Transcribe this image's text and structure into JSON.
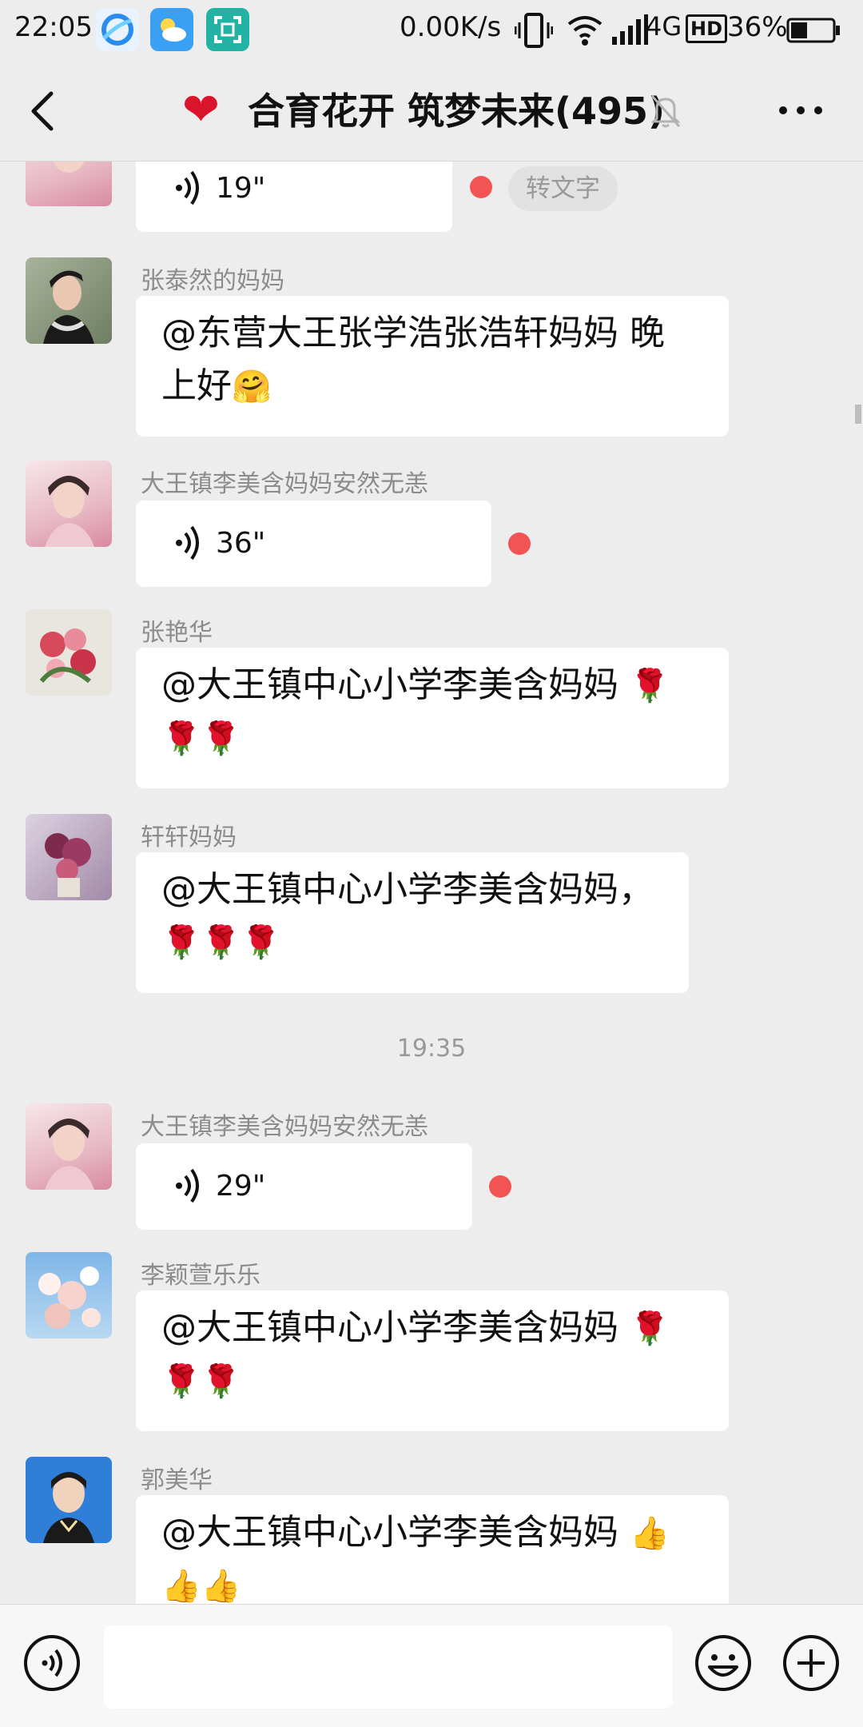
{
  "status_bar": {
    "time": "22:05",
    "network_speed": "0.00K/s",
    "network_type": "4G",
    "hd": "HD",
    "battery": "36%"
  },
  "header": {
    "back_icon": "chevron-left-icon",
    "title": "合育花开 筑梦未来(495)",
    "mute_icon": "bell-muted-icon",
    "more_icon": "more-icon"
  },
  "messages": [
    {
      "type": "voice",
      "duration": "19\"",
      "unread": true,
      "transcribe_label": "转文字"
    },
    {
      "type": "text",
      "sender": "张泰然的妈妈",
      "text_line1": "@东营大王张学浩张浩轩妈妈  晚",
      "text_line2": "上好",
      "emoji": "🤗"
    },
    {
      "type": "voice",
      "sender": "大王镇李美含妈妈安然无恙",
      "duration": "36\"",
      "unread": true
    },
    {
      "type": "text",
      "sender": "张艳华",
      "text_line1": "@大王镇中心小学李美含妈妈",
      "emoji_line1": "🌹",
      "emoji_line2": "🌹🌹"
    },
    {
      "type": "text",
      "sender": "轩轩妈妈",
      "text_line1": "@大王镇中心小学李美含妈妈，",
      "emoji_line2": "🌹🌹🌹"
    },
    {
      "type": "timestamp",
      "text": "19:35"
    },
    {
      "type": "voice",
      "sender": "大王镇李美含妈妈安然无恙",
      "duration": "29\"",
      "unread": true
    },
    {
      "type": "text",
      "sender": "李颖萱乐乐",
      "text_line1": "@大王镇中心小学李美含妈妈",
      "emoji_line1": "🌹",
      "emoji_line2": "🌹🌹"
    },
    {
      "type": "text",
      "sender": "郭美华",
      "text_line1": "@大王镇中心小学李美含妈妈",
      "emoji_line1": "👍",
      "emoji_line2": "👍👍"
    }
  ],
  "input_bar": {
    "voice_icon": "voice-input-icon",
    "emoji_icon": "emoji-icon",
    "plus_icon": "plus-icon",
    "placeholder": ""
  },
  "colors": {
    "background": "#ededed",
    "bubble": "#ffffff",
    "unread_dot": "#f25353",
    "heart": "#d9142b"
  }
}
